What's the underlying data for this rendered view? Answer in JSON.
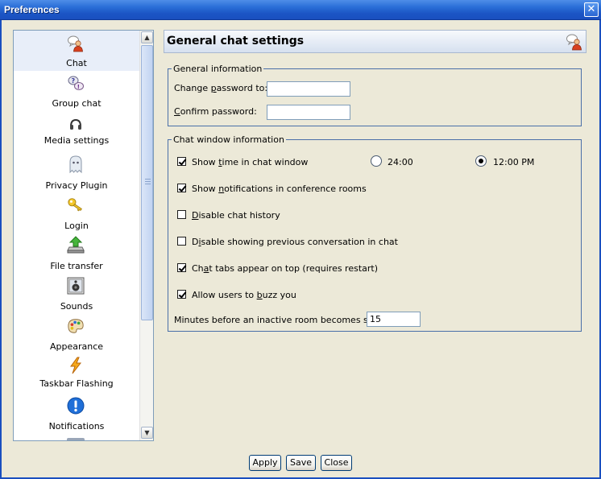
{
  "window": {
    "title": "Preferences",
    "close_glyph": "✕"
  },
  "sidebar": {
    "items": [
      {
        "label": "Chat",
        "icon": "chat-person-icon"
      },
      {
        "label": "Group chat",
        "icon": "group-chat-icon"
      },
      {
        "label": "Media settings",
        "icon": "headset-icon"
      },
      {
        "label": "Privacy Plugin",
        "icon": "ghost-icon"
      },
      {
        "label": "Login",
        "icon": "key-icon"
      },
      {
        "label": "File transfer",
        "icon": "file-transfer-icon"
      },
      {
        "label": "Sounds",
        "icon": "speaker-icon"
      },
      {
        "label": "Appearance",
        "icon": "palette-icon"
      },
      {
        "label": "Taskbar Flashing",
        "icon": "lightning-icon"
      },
      {
        "label": "Notifications",
        "icon": "exclamation-icon"
      }
    ],
    "selected_index": 0,
    "scroll_up": "▲",
    "scroll_down": "▼"
  },
  "panel": {
    "heading": "General chat settings",
    "general": {
      "legend": "General information",
      "change_password": {
        "pre": "Change ",
        "key": "p",
        "post": "assword to:",
        "value": ""
      },
      "confirm_password": {
        "pre": "",
        "key": "C",
        "post": "onfirm password:",
        "value": ""
      }
    },
    "chat_window": {
      "legend": "Chat window information",
      "show_time": {
        "pre": "Show ",
        "key": "t",
        "post": "ime in chat window",
        "checked": true
      },
      "time_formats": [
        {
          "label": "24:00",
          "selected": false
        },
        {
          "label": "12:00 PM",
          "selected": true
        }
      ],
      "show_notifications": {
        "pre": "Show ",
        "key": "n",
        "post": "otifications in conference rooms",
        "checked": true
      },
      "disable_history": {
        "pre": "",
        "key": "D",
        "post": "isable chat history",
        "checked": false
      },
      "disable_previous": {
        "pre": "D",
        "key": "i",
        "post": "sable showing previous conversation in chat",
        "checked": false
      },
      "tabs_on_top": {
        "pre": "Ch",
        "key": "a",
        "post": "t tabs appear on top (requires restart)",
        "checked": true
      },
      "allow_buzz": {
        "pre": "Allow users to ",
        "key": "b",
        "post": "uzz you",
        "checked": true
      },
      "stale_minutes": {
        "label": "Minutes before an inactive room becomes stale:",
        "value": "15"
      }
    }
  },
  "buttons": {
    "apply": "Apply",
    "save": "Save",
    "close": "Close"
  }
}
